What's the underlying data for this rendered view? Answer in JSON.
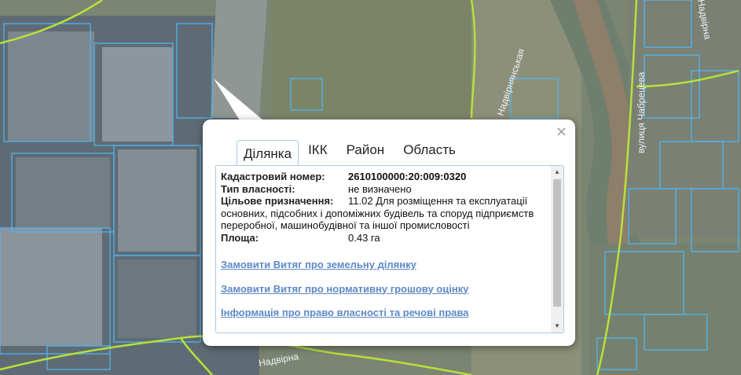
{
  "map": {
    "street_labels": [
      "Надвірнянськая",
      "вулиця Чабрецева",
      "Надвірна",
      "Надвірна"
    ],
    "colors": {
      "parcel": "#4fb4f0",
      "road_line": "#b6e13a"
    }
  },
  "popup": {
    "close_icon": "×",
    "tabs": [
      "Ділянка",
      "ІКК",
      "Район",
      "Область"
    ],
    "active_tab": "Ділянка",
    "fields": {
      "cadastral_label": "Кадастровий номер:",
      "cadastral_value": "2610100000:20:009:0320",
      "ownership_label": "Тип власності:",
      "ownership_value": "не визначено",
      "purpose_label": "Цільове призначення:",
      "purpose_value": "11.02 Для розміщення та експлуатації основних, підсобних і допоміжних будівель та споруд підприємств переробної, машинобудівної та іншої промисловості",
      "area_label": "Площа:",
      "area_value": "0.43 га"
    },
    "links": [
      "Замовити Витяг про земельну ділянку",
      "Замовити Витяг про нормативну грошову оцінку",
      "Інформація про право власності та речові права"
    ]
  }
}
